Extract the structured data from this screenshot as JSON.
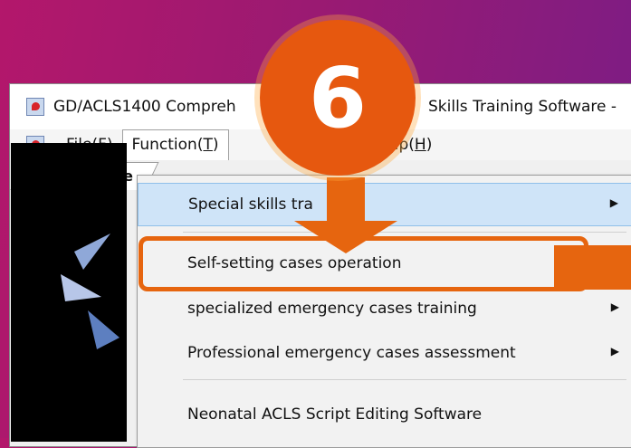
{
  "window": {
    "title_left": "GD/ACLS1400 Compreh",
    "title_right": "Skills Training Software -"
  },
  "menubar": {
    "file": "File(F)",
    "function": "Function(T)",
    "help": "Help(H)"
  },
  "tabs": {
    "scroll_left": "◁",
    "active_label": "We"
  },
  "dropdown": {
    "items": [
      {
        "label": "Special skills tra",
        "has_submenu": true
      },
      {
        "label": "Self-setting cases operation",
        "has_submenu": false
      },
      {
        "label": "specialized emergency cases training",
        "has_submenu": true
      },
      {
        "label": "Professional emergency cases assessment",
        "has_submenu": true
      },
      {
        "label": "Neonatal ACLS Script Editing Software",
        "has_submenu": false
      }
    ],
    "submenu_arrow": "▶"
  },
  "annotation": {
    "step_number": "6",
    "color": "#e6650f"
  }
}
